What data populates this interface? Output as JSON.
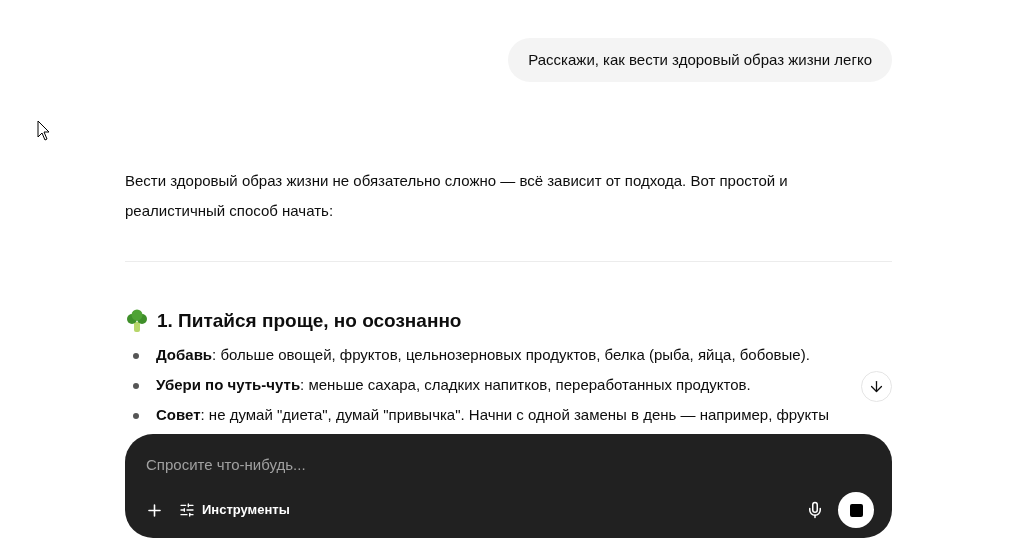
{
  "user_message": "Расскажи, как вести здоровый образ жизни легко",
  "answer": {
    "intro": "Вести здоровый образ жизни не обязательно сложно — всё зависит от подхода. Вот простой и реалистичный способ начать:",
    "heading": "1. Питайся проще, но осознанно",
    "bullets": [
      "**Добавь**: больше овощей, фруктов, цельнозерновых продуктов, белка (рыба, яйца, бобовые).",
      "**Убери по чуть-чуть**: меньше сахара, сладких напитков, переработанных продуктов.",
      "**Совет**: не думай \"диета\", думай \"привычка\". Начни с одной замены в день — например, фрукты"
    ]
  },
  "composer": {
    "placeholder": "Спросите что-нибудь...",
    "tools_label": "Инструменты"
  }
}
